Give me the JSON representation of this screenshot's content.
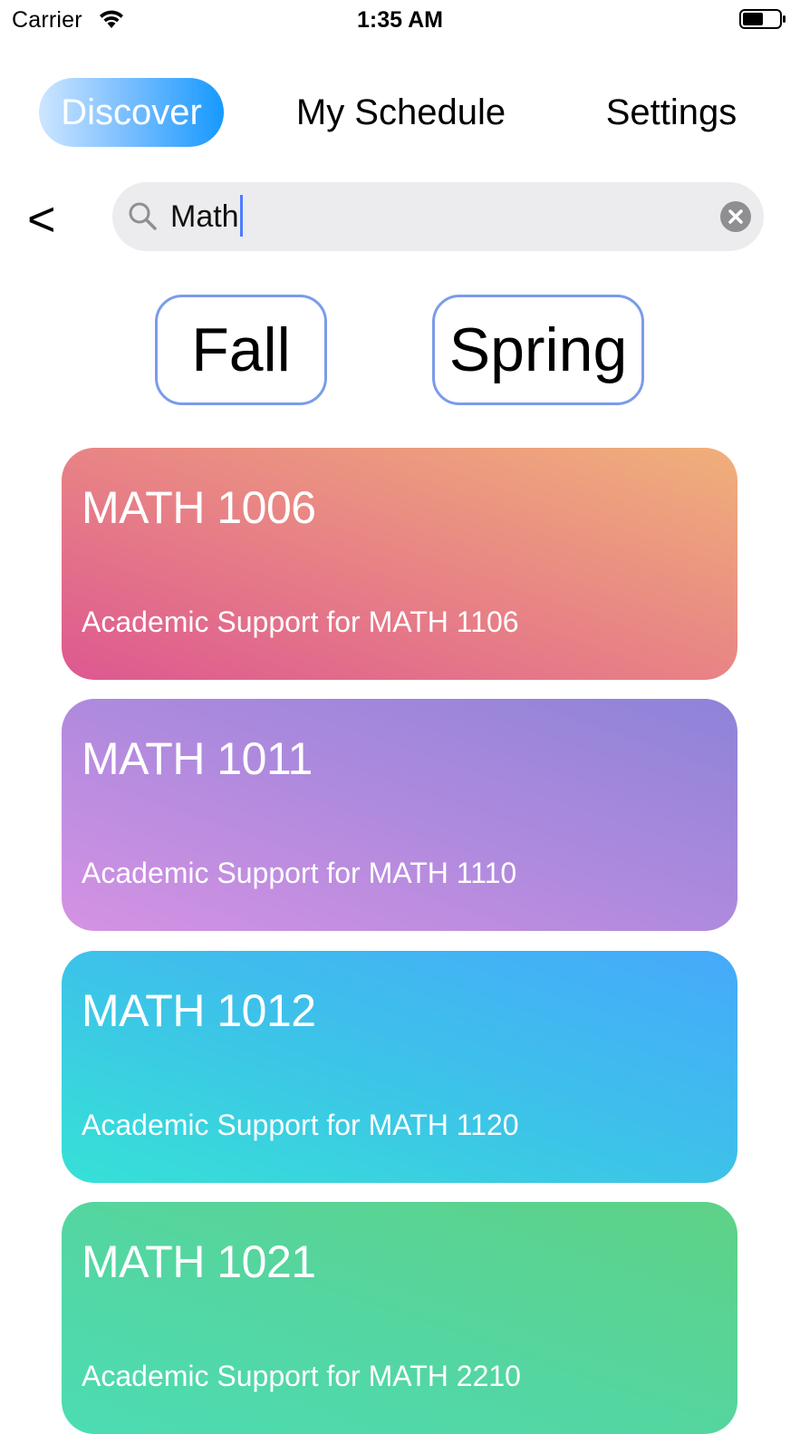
{
  "status_bar": {
    "carrier": "Carrier",
    "time": "1:35 AM"
  },
  "tabs": [
    {
      "label": "Discover",
      "selected": true
    },
    {
      "label": "My Schedule",
      "selected": false
    },
    {
      "label": "Settings",
      "selected": false
    }
  ],
  "search": {
    "back_label": "<",
    "query": "Math"
  },
  "semesters": [
    {
      "label": "Fall"
    },
    {
      "label": "Spring"
    }
  ],
  "courses": [
    {
      "code": "MATH 1006",
      "description": "Academic Support for MATH 1106",
      "gradient": [
        "#dd5890",
        "#e88485",
        "#f0b07a"
      ]
    },
    {
      "code": "MATH 1011",
      "description": "Academic Support for MATH 1110",
      "gradient": [
        "#d592e3",
        "#af8ade",
        "#8e83d8"
      ]
    },
    {
      "code": "MATH 1012",
      "description": "Academic Support for MATH 1120",
      "gradient": [
        "#36e1d6",
        "#3dc2e9",
        "#46a9fb"
      ]
    },
    {
      "code": "MATH 1021",
      "description": "Academic Support for MATH 2210",
      "gradient": [
        "#4cdcb4",
        "#55d59f",
        "#5ed286"
      ]
    }
  ],
  "icons": {
    "wifi": "wifi-icon",
    "battery": "battery-icon",
    "search": "search-icon",
    "clear": "clear-icon"
  }
}
